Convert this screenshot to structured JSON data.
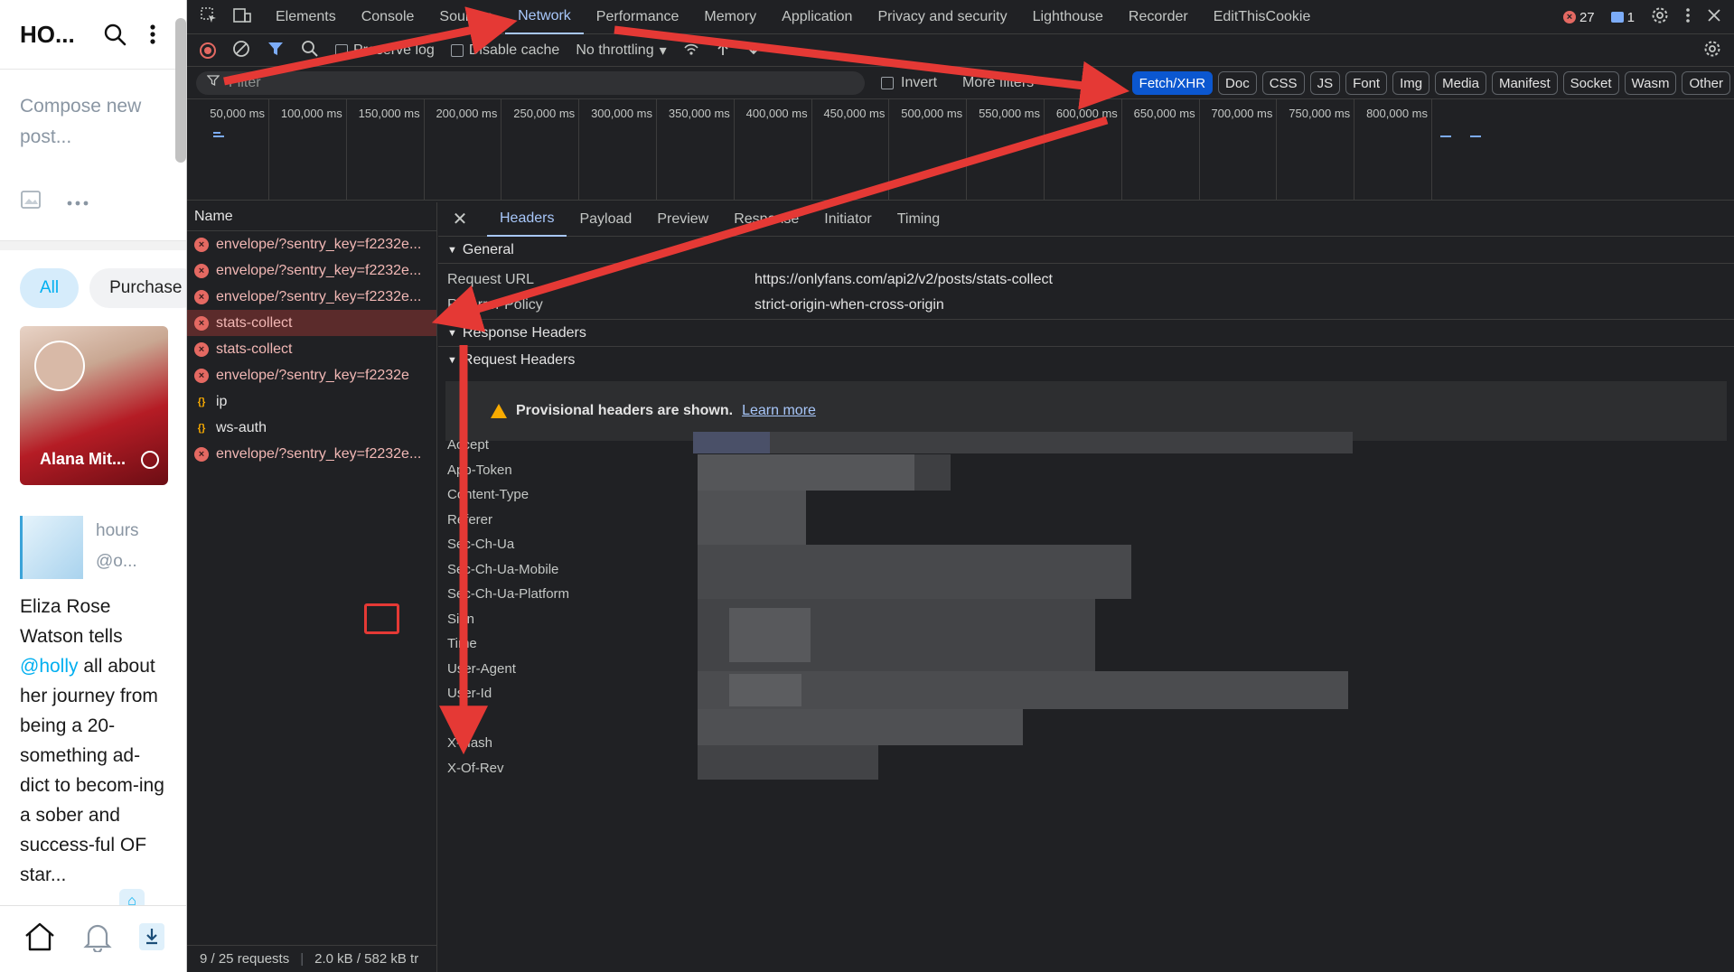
{
  "site": {
    "title": "HO...",
    "compose_placeholder": "Compose new post...",
    "filter_all": "All",
    "filter_purchased": "Purchase",
    "card_name": "Alana Mit...",
    "post_meta_time": "hours",
    "post_meta_handle": "@o...",
    "post_text_before": "Eliza Rose Watson tells ",
    "post_mention": "@holly",
    "post_text_after": " all about her journey from being a 20-something ad-dict to becom-ing a sober and success-ful OF star..."
  },
  "devtools": {
    "tabs": [
      "Elements",
      "Console",
      "Sources",
      "Network",
      "Performance",
      "Memory",
      "Application",
      "Privacy and security",
      "Lighthouse",
      "Recorder",
      "EditThisCookie"
    ],
    "active_tab": "Network",
    "error_count": "27",
    "message_count": "1",
    "toolbar": {
      "preserve_log": "Preserve log",
      "disable_cache": "Disable cache",
      "throttling": "No throttling"
    },
    "filter": {
      "placeholder": "Filter",
      "invert": "Invert",
      "more_filters": "More filters",
      "types": [
        "Fetch/XHR",
        "Doc",
        "CSS",
        "JS",
        "Font",
        "Img",
        "Media",
        "Manifest",
        "Socket",
        "Wasm",
        "Other"
      ],
      "active_type": "Fetch/XHR"
    },
    "timeline_ticks": [
      "50,000 ms",
      "100,000 ms",
      "150,000 ms",
      "200,000 ms",
      "250,000 ms",
      "300,000 ms",
      "350,000 ms",
      "400,000 ms",
      "450,000 ms",
      "500,000 ms",
      "550,000 ms",
      "600,000 ms",
      "650,000 ms",
      "700,000 ms",
      "750,000 ms",
      "800,000 ms"
    ],
    "name_header": "Name",
    "requests": [
      {
        "name": "envelope/?sentry_key=f2232e...",
        "status": "error"
      },
      {
        "name": "envelope/?sentry_key=f2232e...",
        "status": "error"
      },
      {
        "name": "envelope/?sentry_key=f2232e...",
        "status": "error"
      },
      {
        "name": "stats-collect",
        "status": "error",
        "selected": true
      },
      {
        "name": "stats-collect",
        "status": "error"
      },
      {
        "name": "envelope/?sentry_key=f2232e",
        "status": "error"
      },
      {
        "name": "ip",
        "status": "ok"
      },
      {
        "name": "ws-auth",
        "status": "ok"
      },
      {
        "name": "envelope/?sentry_key=f2232e...",
        "status": "error"
      }
    ],
    "status_requests": "9 / 25 requests",
    "status_transferred": "2.0 kB / 582 kB tr",
    "detail_tabs": [
      "Headers",
      "Payload",
      "Preview",
      "Response",
      "Initiator",
      "Timing"
    ],
    "active_detail_tab": "Headers",
    "general_title": "General",
    "request_url_label": "Request URL",
    "request_url": "https://onlyfans.com/api2/v2/posts/stats-collect",
    "referrer_policy_label": "Referrer Policy",
    "referrer_policy": "strict-origin-when-cross-origin",
    "response_headers_title": "Response Headers",
    "request_headers_title": "Request Headers",
    "provisional_text": "Provisional headers are shown.",
    "learn_more": "Learn more",
    "header_names": [
      "Accept",
      "App-Token",
      "Content-Type",
      "Referer",
      "Sec-Ch-Ua",
      "Sec-Ch-Ua-Mobile",
      "Sec-Ch-Ua-Platform",
      "Sign",
      "Time",
      "User-Agent",
      "User-Id",
      "X-Bc",
      "X-Hash",
      "X-Of-Rev"
    ],
    "highlighted_header": "X-Bc"
  },
  "colors": {
    "annotation_red": "#e53935",
    "accent_blue": "#a8c7fa",
    "error_red": "#e46962"
  }
}
